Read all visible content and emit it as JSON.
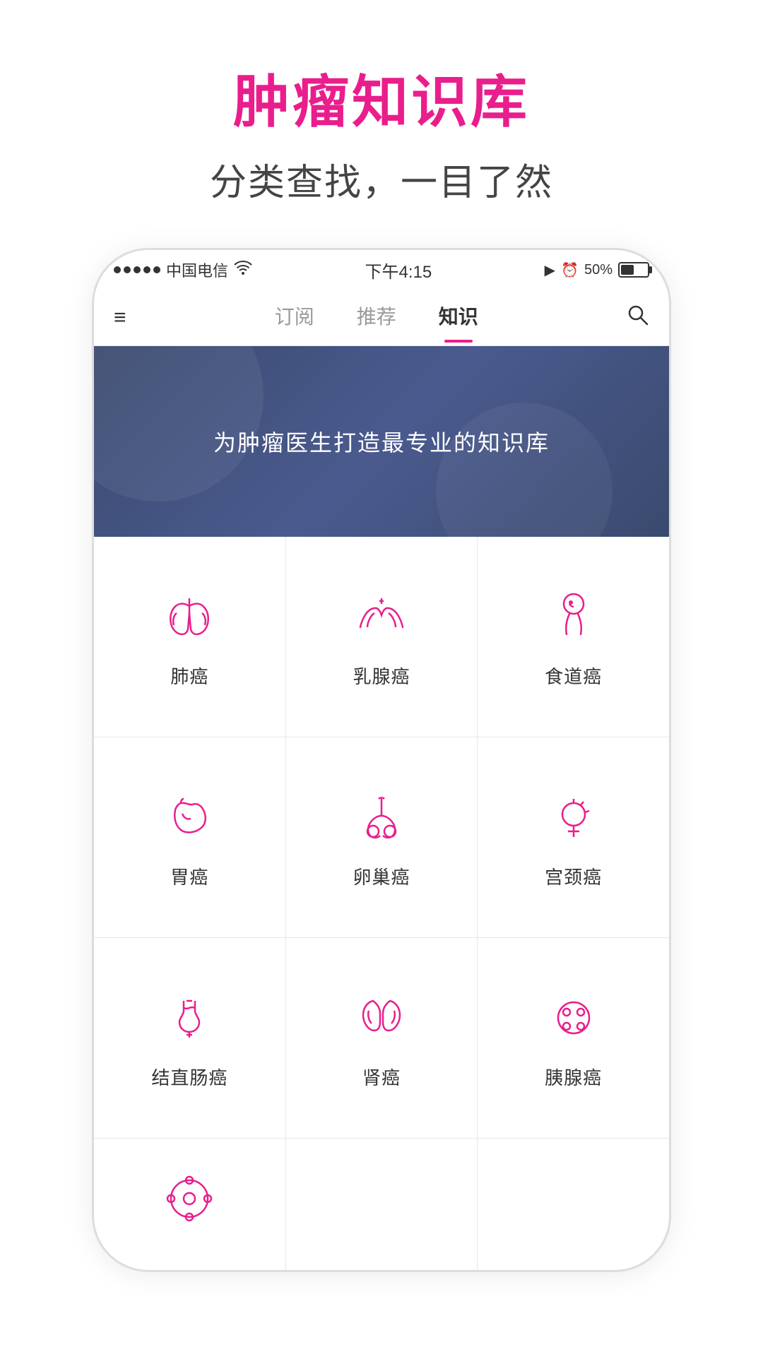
{
  "page": {
    "title": "肿瘤知识库",
    "subtitle": "分类查找，一目了然"
  },
  "status_bar": {
    "carrier": "中国电信",
    "time": "下午4:15",
    "battery": "50%"
  },
  "tabs": [
    {
      "label": "订阅",
      "active": false
    },
    {
      "label": "推荐",
      "active": false
    },
    {
      "label": "知识",
      "active": true
    }
  ],
  "banner": {
    "text": "为肿瘤医生打造最专业的知识库"
  },
  "grid_items": [
    {
      "id": "lung",
      "label": "肺癌",
      "icon": "lung"
    },
    {
      "id": "breast",
      "label": "乳腺癌",
      "icon": "breast"
    },
    {
      "id": "esophagus",
      "label": "食道癌",
      "icon": "esophagus"
    },
    {
      "id": "stomach",
      "label": "胃癌",
      "icon": "stomach"
    },
    {
      "id": "ovary",
      "label": "卵巢癌",
      "icon": "ovary"
    },
    {
      "id": "cervix",
      "label": "宫颈癌",
      "icon": "cervix"
    },
    {
      "id": "colorectal",
      "label": "结直肠癌",
      "icon": "colorectal"
    },
    {
      "id": "kidney",
      "label": "肾癌",
      "icon": "kidney"
    },
    {
      "id": "pancreas",
      "label": "胰腺癌",
      "icon": "pancreas"
    },
    {
      "id": "other",
      "label": "",
      "icon": "other",
      "partial": true
    }
  ],
  "colors": {
    "primary": "#e91e8c",
    "dark_navy": "#3a4a6e",
    "icon_pink": "#e91e8c"
  }
}
